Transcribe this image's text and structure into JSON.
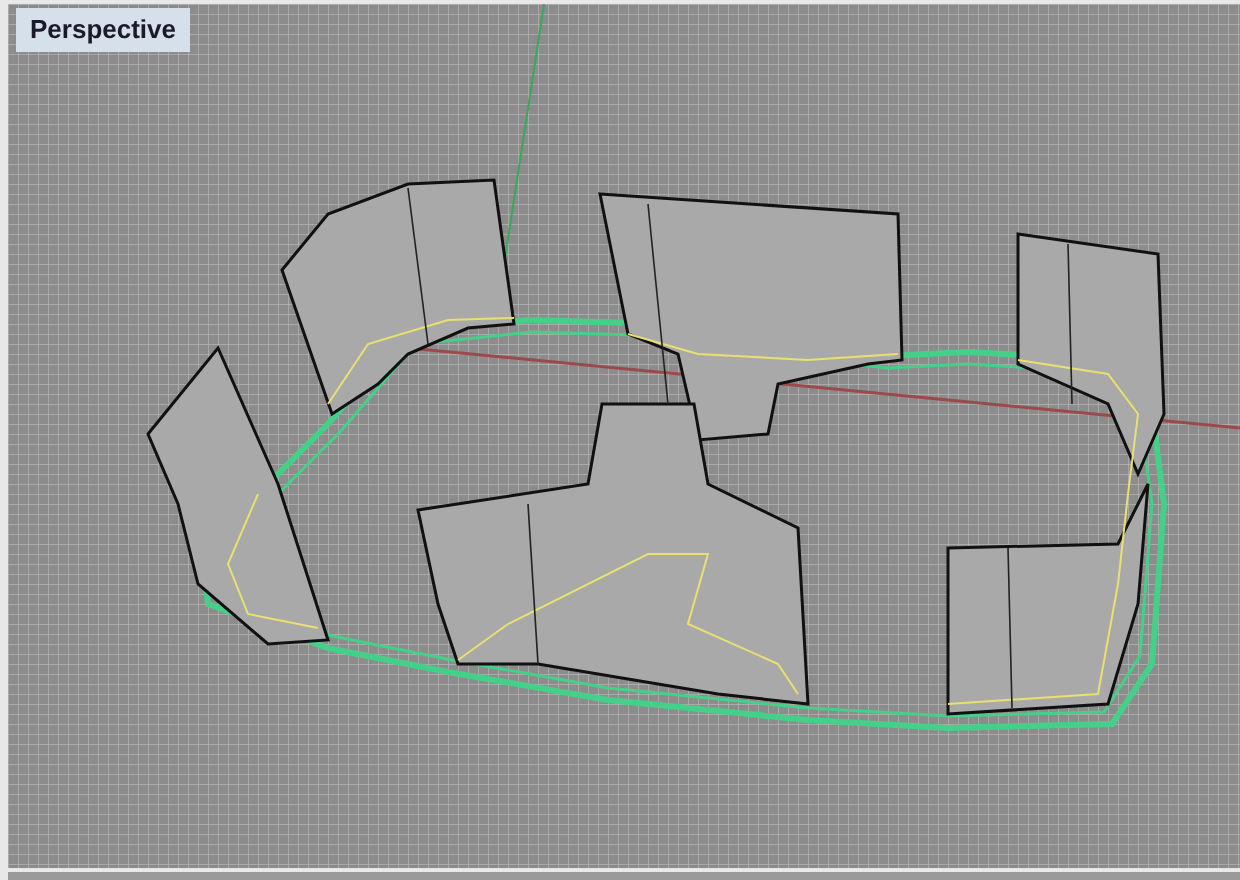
{
  "viewport": {
    "title": "Perspective"
  }
}
